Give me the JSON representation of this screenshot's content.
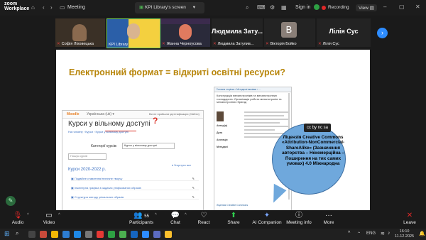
{
  "window": {
    "app_name": "zoom",
    "app_subname": "Workplace",
    "meeting_label": "Meeting",
    "screen_tab_label": "KPI Library's screen",
    "sign_in": "Sign in",
    "recording": "Recording",
    "view": "View"
  },
  "participants": [
    {
      "name": "Софія Ліховецька"
    },
    {
      "name": "KPI Library"
    },
    {
      "name": "Жанна Черноусова"
    },
    {
      "name": "Людмила Затулив..."
    },
    {
      "name": "Вікторія Бойко"
    },
    {
      "name": "Лілія Сус"
    }
  ],
  "big_names": {
    "lyudmyla": "Людмила  Зату...",
    "viktoriia_initial": "B",
    "liliia": "Лілія Сус"
  },
  "slide": {
    "title": "Електронний формат = відкриті освітні ресурси?",
    "moodle": {
      "logo": "Moodle",
      "menu": "Українська (uk) ▾",
      "login_note": "Ви не пройшли ідентифікацію (Увійти)",
      "course_heading": "Курси у вільному доступі",
      "question_mark": "?",
      "breadcrumb": "На головну  ›  Курси  ›  Курси у вільному доступі",
      "category_label": "Категорії курсів:",
      "category_value": "Курси у вільному доступі",
      "search_placeholder": "Пошук курсів",
      "collapse_all": "▾ Згорнути все",
      "year_heading": "Курси 2020-2022 р.",
      "courses": [
        "Подвійне ставлення/технічне  творчу",
        "Інженерна графіка в задачах уніфікованих образів",
        "Структура методу унікальних образів"
      ]
    },
    "repo": {
      "breadcrumb": "Головна сторінка › Методичні вказівки › ...",
      "title": "Конструкція механотроніків та механотронних господарств: Організація роботи механотронів та механотронних бригад",
      "field_labels": [
        "Автор(и)",
        "Дата",
        "Анотація",
        "Метадані"
      ],
      "license_note": "Ліцензія Creative Commons"
    },
    "bubble": {
      "badge": "cc by nc sa",
      "text": "Ліцензія Creative Commons «Attribution-NonCommercial-ShareAlike» (Зазначення авторства – Некомерційна – Поширення на тих самих умовах) 4.0 Міжнародна"
    }
  },
  "toolbar": {
    "audio": "Audio",
    "video": "Video",
    "participants": "Participants",
    "participants_count": "55",
    "chat": "Chat",
    "react": "React",
    "share": "Share",
    "ai_companion": "AI Companion",
    "meeting_info": "Meeting info",
    "more": "More",
    "leave": "Leave"
  },
  "taskbar": {
    "lang": "ENG",
    "time": "16:10",
    "date": "11.12.2025"
  },
  "colors": {
    "accent_blue": "#2d8cff",
    "leave_red": "#e02828",
    "slide_title": "#b8860b"
  }
}
